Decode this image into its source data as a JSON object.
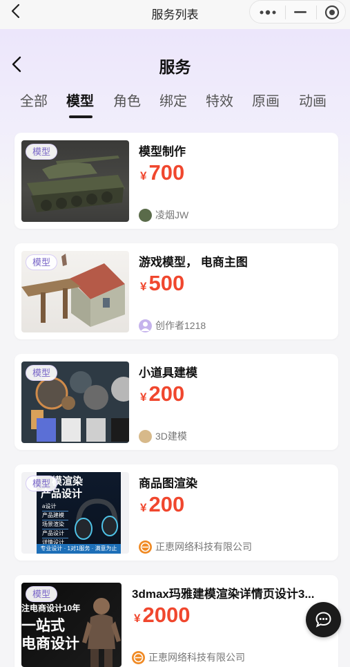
{
  "topbar": {
    "title": "服务列表"
  },
  "header": {
    "title": "服务"
  },
  "tabs": [
    {
      "label": "全部",
      "active": false
    },
    {
      "label": "模型",
      "active": true
    },
    {
      "label": "角色",
      "active": false
    },
    {
      "label": "绑定",
      "active": false
    },
    {
      "label": "特效",
      "active": false
    },
    {
      "label": "原画",
      "active": false
    },
    {
      "label": "动画",
      "active": false
    }
  ],
  "services": [
    {
      "tag": "模型",
      "title": "模型制作",
      "currency": "¥",
      "price": "700",
      "creator": "凌烟JW",
      "image": "tank-model",
      "avatar_color": "#5a6b4a"
    },
    {
      "tag": "模型",
      "title": "游戏模型， 电商主图",
      "currency": "¥",
      "price": "500",
      "creator": "创作者1218",
      "image": "house-model",
      "avatar_color": "#b39ddb"
    },
    {
      "tag": "模型",
      "title": "小道具建模",
      "currency": "¥",
      "price": "200",
      "creator": "3D建模",
      "image": "props-textures",
      "avatar_color": "#d7b98a"
    },
    {
      "tag": "模型",
      "title": "商品图渲染",
      "currency": "¥",
      "price": "200",
      "creator": "正恵网络科技有限公司",
      "image": "headphone-render",
      "ad_text": {
        "line1": "模渲染",
        "line2": "产品设计",
        "items": [
          "a设计",
          "产品建模",
          "场景渲染",
          "产品设计",
          "详情设计"
        ],
        "footer": "专业设计 · 1对1服务 · 满意为止"
      },
      "avatar_color": "#f08a24"
    },
    {
      "tag": "模型",
      "title": "3dmax玛雅建模渲染详情页设计3...",
      "currency": "¥",
      "price": "2000",
      "creator": "正恵网络科技有限公司",
      "image": "figure-render",
      "ad_text": {
        "line1": "注电商设计10年",
        "line2": "一站式",
        "line3": "电商设计"
      },
      "avatar_color": "#f08a24"
    }
  ],
  "colors": {
    "accent": "#f0472e",
    "tag": "#7a67c8",
    "header_bg": "#ece6fb"
  }
}
